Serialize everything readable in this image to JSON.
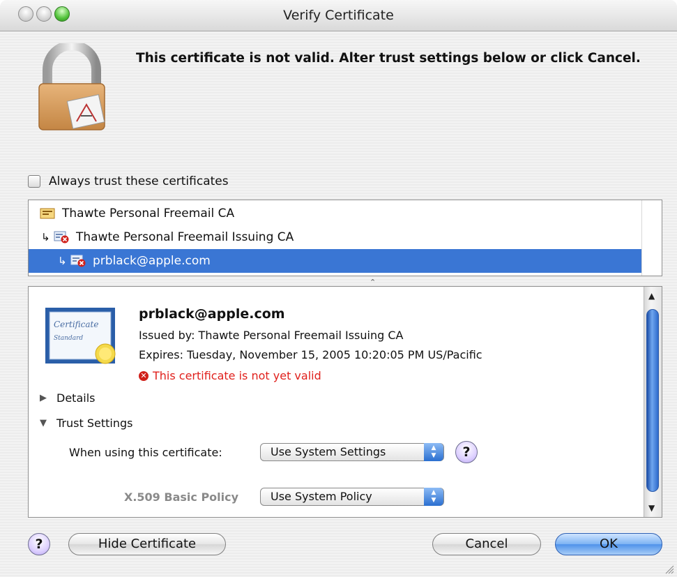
{
  "window": {
    "title": "Verify Certificate"
  },
  "header": {
    "message": "This certificate is not valid. Alter trust settings below or click Cancel."
  },
  "always_trust": {
    "label": "Always trust these certificates",
    "checked": false
  },
  "chain": {
    "items": [
      {
        "label": "Thawte Personal Freemail CA",
        "level": 0,
        "status": "root",
        "selected": false
      },
      {
        "label": "Thawte Personal Freemail Issuing CA",
        "level": 1,
        "status": "invalid",
        "selected": false
      },
      {
        "label": "prblack@apple.com",
        "level": 2,
        "status": "invalid",
        "selected": true
      }
    ]
  },
  "detail": {
    "name": "prblack@apple.com",
    "issued_by": "Issued by: Thawte Personal Freemail Issuing CA",
    "expires": "Expires: Tuesday, November 15, 2005 10:20:05 PM US/Pacific",
    "error": "This certificate is not yet valid",
    "error_glyph": "✕",
    "cert_art_text_1": "Certificate",
    "cert_art_text_2": "Standard",
    "details_label": "Details",
    "trust_label": "Trust Settings",
    "when_using_label": "When using this certificate:",
    "when_using_value": "Use System Settings",
    "policy_label": "X.509 Basic Policy",
    "policy_value": "Use System Policy"
  },
  "buttons": {
    "help": "?",
    "hide_certificate": "Hide Certificate",
    "cancel": "Cancel",
    "ok": "OK"
  },
  "colors": {
    "selection": "#3a76d4",
    "error": "#e0201c",
    "default_button": "#4f92ea"
  }
}
